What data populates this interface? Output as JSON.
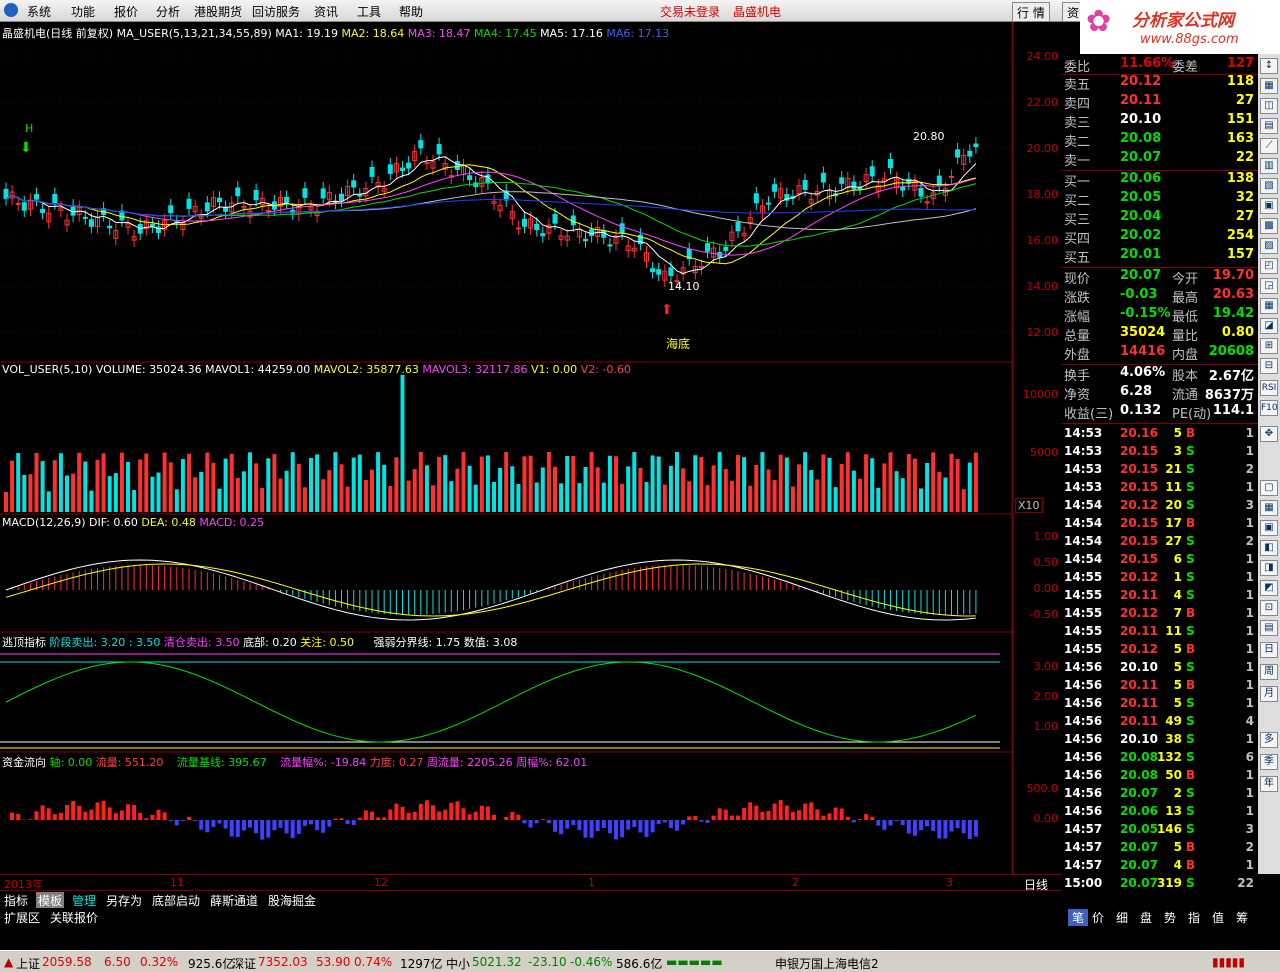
{
  "menu": {
    "items": [
      "系统",
      "功能",
      "报价",
      "分析",
      "港股期货",
      "回访服务",
      "资讯",
      "工具",
      "帮助"
    ],
    "warn": "交易未登录",
    "company": "晶盛机电",
    "tab1": "行 情",
    "tab2": "资"
  },
  "logo": {
    "title": "分析家公式网",
    "url": "www.88gs.com"
  },
  "main": {
    "title": "晶盛机电(日线 前复权)  MA_USER(5,13,21,34,55,89)",
    "ma1": "MA1: 19.19",
    "ma2": "MA2: 18.64",
    "ma3": "MA3: 18.47",
    "ma4": "MA4: 17.45",
    "ma5": "MA5: 17.16",
    "ma6": "MA6: 17.13",
    "ticks": [
      "24.00",
      "22.00",
      "20.00",
      "18.00",
      "16.00",
      "14.00",
      "12.00"
    ],
    "high_label": "20.80",
    "low_label": "14.10",
    "marker_h": "H",
    "bottom_label": "海底"
  },
  "vol": {
    "title": "VOL_USER(5,10) VOLUME: 35024.36",
    "mavol1": "MAVOL1: 44259.00",
    "mavol2": "MAVOL2: 35877.63",
    "mavol3": "MAVOL3: 32117.86",
    "v1": "V1: 0.00",
    "v2": "V2: -0.60",
    "ticks": [
      "10000",
      "5000"
    ],
    "unit": "X10"
  },
  "macd": {
    "title": "MACD(12,26,9) DIF: 0.60",
    "dea": "DEA: 0.48",
    "macd": "MACD: 0.25",
    "ticks": [
      "1.00",
      "0.50",
      "0.00",
      "-0.50"
    ]
  },
  "escape": {
    "title": "逃顶指标",
    "s1": "阶段卖出: 3.20 : 3.50",
    "s2": "清仓卖出: 3.50",
    "s3": "底部: 0.20",
    "s4": "关注: 0.50",
    "s5": "强弱分界线: 1.75",
    "s6": "数值: 3.08",
    "ticks": [
      "3.00",
      "2.00",
      "1.00"
    ]
  },
  "flow": {
    "title": "资金流向",
    "s1": "轴: 0.00",
    "s2": "流量: 551.20",
    "s3": "流量基线: 395.67",
    "s4": "流量幅%: -19.84",
    "s5": "力度: 0.27",
    "s6": "周流量: 2205.26",
    "s7": "周幅%: 62.01",
    "ticks": [
      "500.0",
      "0.00"
    ]
  },
  "dates": [
    "2013年",
    "11",
    "12",
    "1",
    "2",
    "3"
  ],
  "period": "日线",
  "quote": {
    "top": [
      {
        "l": "委比",
        "v": "11.66%",
        "l2": "委差",
        "v2": "127"
      }
    ],
    "asks": [
      {
        "l": "卖五",
        "p": "20.12",
        "v": "118"
      },
      {
        "l": "卖四",
        "p": "20.11",
        "v": "27"
      },
      {
        "l": "卖三",
        "p": "20.10",
        "v": "151"
      },
      {
        "l": "卖二",
        "p": "20.08",
        "v": "163"
      },
      {
        "l": "卖一",
        "p": "20.07",
        "v": "22"
      }
    ],
    "bids": [
      {
        "l": "买一",
        "p": "20.06",
        "v": "138"
      },
      {
        "l": "买二",
        "p": "20.05",
        "v": "32"
      },
      {
        "l": "买三",
        "p": "20.04",
        "v": "27"
      },
      {
        "l": "买四",
        "p": "20.02",
        "v": "254"
      },
      {
        "l": "买五",
        "p": "20.01",
        "v": "157"
      }
    ],
    "stats": [
      {
        "l": "现价",
        "v": "20.07",
        "l2": "今开",
        "v2": "19.70"
      },
      {
        "l": "涨跌",
        "v": "-0.03",
        "l2": "最高",
        "v2": "20.63"
      },
      {
        "l": "涨幅",
        "v": "-0.15%",
        "l2": "最低",
        "v2": "19.42"
      },
      {
        "l": "总量",
        "v": "35024",
        "l2": "量比",
        "v2": "0.80"
      },
      {
        "l": "外盘",
        "v": "14416",
        "l2": "内盘",
        "v2": "20608"
      }
    ],
    "info": [
      {
        "l": "换手",
        "v": "4.06%",
        "l2": "股本",
        "v2": "2.67亿"
      },
      {
        "l": "净资",
        "v": "6.28",
        "l2": "流通",
        "v2": "8637万"
      },
      {
        "l": "收益(三)",
        "v": "0.132",
        "l2": "PE(动)",
        "v2": "114.1"
      }
    ]
  },
  "ticks_list": [
    [
      "14:53",
      "20.16",
      "5",
      "B",
      "1"
    ],
    [
      "14:53",
      "20.15",
      "3",
      "S",
      "1"
    ],
    [
      "14:53",
      "20.15",
      "21",
      "S",
      "2"
    ],
    [
      "14:53",
      "20.15",
      "11",
      "S",
      "1"
    ],
    [
      "14:54",
      "20.12",
      "20",
      "S",
      "3"
    ],
    [
      "14:54",
      "20.15",
      "17",
      "B",
      "1"
    ],
    [
      "14:54",
      "20.15",
      "27",
      "S",
      "2"
    ],
    [
      "14:54",
      "20.15",
      "6",
      "S",
      "1"
    ],
    [
      "14:55",
      "20.12",
      "1",
      "S",
      "1"
    ],
    [
      "14:55",
      "20.11",
      "4",
      "S",
      "1"
    ],
    [
      "14:55",
      "20.12",
      "7",
      "B",
      "1"
    ],
    [
      "14:55",
      "20.11",
      "11",
      "S",
      "1"
    ],
    [
      "14:55",
      "20.12",
      "5",
      "B",
      "1"
    ],
    [
      "14:56",
      "20.10",
      "5",
      "S",
      "1"
    ],
    [
      "14:56",
      "20.11",
      "5",
      "B",
      "1"
    ],
    [
      "14:56",
      "20.11",
      "5",
      "S",
      "1"
    ],
    [
      "14:56",
      "20.11",
      "49",
      "S",
      "4"
    ],
    [
      "14:56",
      "20.10",
      "38",
      "S",
      "1"
    ],
    [
      "14:56",
      "20.08",
      "132",
      "S",
      "6"
    ],
    [
      "14:56",
      "20.08",
      "50",
      "B",
      "1"
    ],
    [
      "14:56",
      "20.07",
      "2",
      "S",
      "1"
    ],
    [
      "14:56",
      "20.06",
      "13",
      "S",
      "1"
    ],
    [
      "14:57",
      "20.05",
      "146",
      "S",
      "3"
    ],
    [
      "14:57",
      "20.07",
      "5",
      "B",
      "2"
    ],
    [
      "14:57",
      "20.07",
      "4",
      "B",
      "1"
    ],
    [
      "15:00",
      "20.07",
      "319",
      "S",
      "22"
    ]
  ],
  "bottom_tabs": [
    "指标",
    "模板",
    "管理",
    "另存为",
    "底部启动",
    "薛斯通道",
    "股海掘金"
  ],
  "bottom_tabs2": [
    "扩展区",
    "关联报价"
  ],
  "quote_tabs": [
    "笔",
    "价",
    "细",
    "盘",
    "势",
    "指",
    "值",
    "筹"
  ],
  "toolbar": [
    "周",
    "月",
    "多",
    "季",
    "年",
    "RSI",
    "F10"
  ],
  "status": {
    "sh": "上证",
    "sh_v": "2059.58",
    "sh_c": "6.50",
    "sh_p": "0.32%",
    "sh_a": "925.6亿",
    "sz": "深证",
    "sz_v": "7352.03",
    "sz_c": "53.90",
    "sz_p": "0.74%",
    "sz_a": "1297亿",
    "zx": "中小",
    "zx_v": "5021.32",
    "zx_c": "-23.10",
    "zx_p": "-0.46%",
    "zx_a": "586.6亿",
    "broker": "申银万国上海电信2"
  }
}
